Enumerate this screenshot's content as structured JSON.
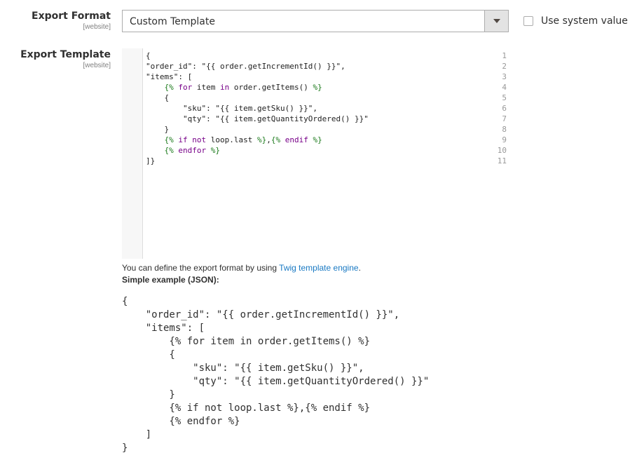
{
  "export_format": {
    "label": "Export Format",
    "scope": "[website]",
    "selected": "Custom Template",
    "use_system_value": "Use system value"
  },
  "export_template": {
    "label": "Export Template",
    "scope": "[website]",
    "line_numbers": [
      "1",
      "2",
      "3",
      "4",
      "5",
      "6",
      "7",
      "8",
      "9",
      "10",
      "11"
    ],
    "code_lines": [
      "{",
      "\"order_id\": \"{{ order.getIncrementId() }}\",",
      "\"items\": [",
      "    {% for item in order.getItems() %}",
      "    {",
      "        \"sku\": \"{{ item.getSku() }}\",",
      "        \"qty\": \"{{ item.getQuantityOrdered() }}\"",
      "    }",
      "    {% if not loop.last %},{% endif %}",
      "    {% endfor %}",
      "]}"
    ]
  },
  "hint": {
    "text": "You can define the export format by using ",
    "link": "Twig template engine",
    "suffix": "."
  },
  "example": {
    "title": "Simple example (JSON):",
    "lines": [
      "{",
      "    \"order_id\": \"{{ order.getIncrementId() }}\",",
      "    \"items\": [",
      "        {% for item in order.getItems() %}",
      "        {",
      "            \"sku\": \"{{ item.getSku() }}\",",
      "            \"qty\": \"{{ item.getQuantityOrdered() }}\"",
      "        }",
      "        {% if not loop.last %},{% endif %}",
      "        {% endfor %}",
      "    ]",
      "}"
    ]
  }
}
